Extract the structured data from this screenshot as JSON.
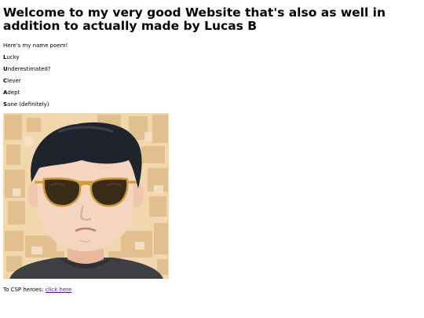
{
  "page": {
    "heading": "Welcome to my very good Website that's also as well in addition to actually made by Lucas B",
    "intro": "Here's my name poem!"
  },
  "poem": [
    {
      "initial": "L",
      "rest": "ucky"
    },
    {
      "initial": "U",
      "rest": "nderestimated?"
    },
    {
      "initial": "C",
      "rest": "lever"
    },
    {
      "initial": "A",
      "rest": "dept"
    },
    {
      "initial": "S",
      "rest": "ane (definitely)"
    }
  ],
  "avatar": {
    "icon": "cartoon-avatar-sunglasses",
    "colors": {
      "background": "#f2d6ad",
      "tiles": "#dfbb8a",
      "hair": "#1f232b",
      "skin": "#f6d5c0",
      "lens": "#3a2a18",
      "frame": "#c99a3a",
      "shirt": "#3e3f42"
    }
  },
  "footer": {
    "prefix": "To CSP heroes: ",
    "link_text": "click here",
    "link_color": "#551a8b"
  }
}
